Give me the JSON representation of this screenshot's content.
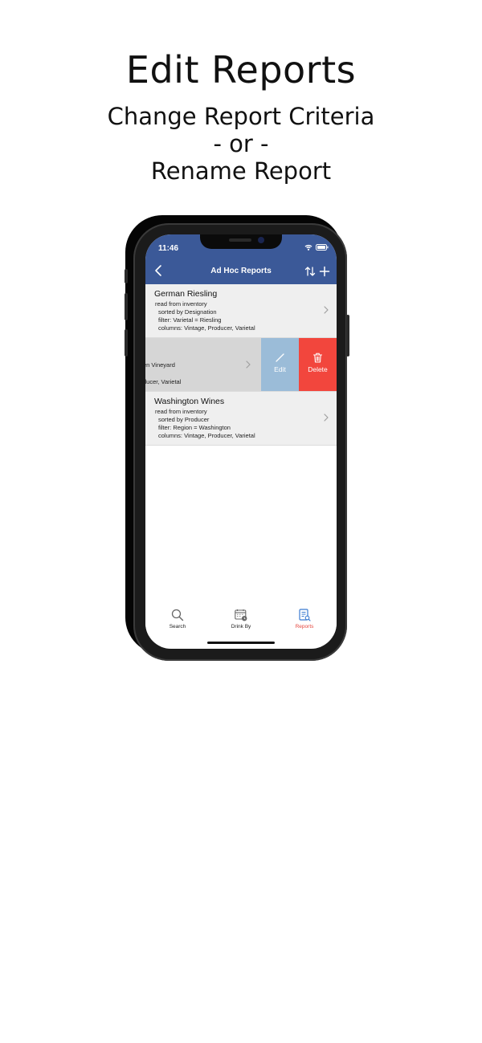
{
  "promo": {
    "title": "Edit Reports",
    "line1": "Change Report Criteria",
    "line2": "- or -",
    "line3": "Rename Report"
  },
  "status_bar": {
    "time": "11:46"
  },
  "nav": {
    "title": "Ad Hoc Reports",
    "back_icon": "chevron-left-icon",
    "sort_icon": "sort-arrows-icon",
    "add_icon": "plus-icon"
  },
  "reports": [
    {
      "title": "German Riesling",
      "source": "read from inventory",
      "sort": "sorted by Designation",
      "filter": "filter: Varietal = Riesling",
      "columns": "columns: Vintage, Producer, Varietal"
    },
    {
      "swiped": true,
      "line1": "en Vineyard",
      "line2": "ducer, Varietal"
    },
    {
      "title": "Washington Wines",
      "source": "read from inventory",
      "sort": "sorted by Producer",
      "filter": "filter: Region = Washington",
      "columns": "columns: Vintage, Producer, Varietal"
    }
  ],
  "swipe_actions": {
    "edit_label": "Edit",
    "delete_label": "Delete",
    "edit_color": "#9bbcd8",
    "delete_color": "#f2463d"
  },
  "tabs": [
    {
      "label": "Search",
      "icon": "search-icon",
      "active": false
    },
    {
      "label": "Drink By",
      "icon": "calendar-clock-icon",
      "active": false
    },
    {
      "label": "Reports",
      "icon": "report-icon",
      "active": true
    }
  ],
  "colors": {
    "nav_bar": "#3b5998",
    "active_tab": "#e5473f"
  }
}
